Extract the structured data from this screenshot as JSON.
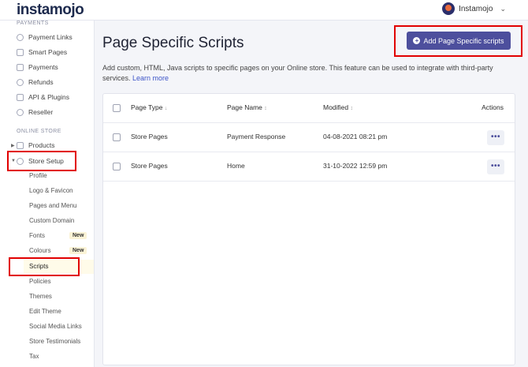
{
  "app": {
    "logo": "instamojo"
  },
  "user": {
    "name": "Instamojo"
  },
  "sidebar": {
    "payments_label": "PAYMENTS",
    "payments": [
      {
        "label": "Payment Links",
        "icon": "link-icon"
      },
      {
        "label": "Smart Pages",
        "icon": "page-icon"
      },
      {
        "label": "Payments",
        "icon": "card-icon"
      },
      {
        "label": "Refunds",
        "icon": "refund-icon"
      },
      {
        "label": "API & Plugins",
        "icon": "plug-icon"
      },
      {
        "label": "Reseller",
        "icon": "reseller-icon"
      }
    ],
    "store_label": "ONLINE STORE",
    "products": "Products",
    "store_setup": "Store Setup",
    "sub": [
      {
        "label": "Profile"
      },
      {
        "label": "Logo & Favicon"
      },
      {
        "label": "Pages and Menu"
      },
      {
        "label": "Custom Domain"
      },
      {
        "label": "Fonts",
        "badge": "New"
      },
      {
        "label": "Colours",
        "badge": "New"
      },
      {
        "label": "Scripts",
        "active": true
      },
      {
        "label": "Policies"
      },
      {
        "label": "Themes"
      },
      {
        "label": "Edit Theme"
      },
      {
        "label": "Social Media Links"
      },
      {
        "label": "Store Testimonials"
      },
      {
        "label": "Tax"
      }
    ]
  },
  "main": {
    "title": "Page Specific Scripts",
    "add_button": "Add Page Specific scripts",
    "description": "Add custom, HTML, Java scripts to specific pages on your Online store. This feature can be used to integrate with third-party services.",
    "learn_more": "Learn more",
    "table": {
      "headers": {
        "type": "Page Type",
        "name": "Page Name",
        "modified": "Modified",
        "actions": "Actions"
      },
      "rows": [
        {
          "type": "Store Pages",
          "name": "Payment Response",
          "modified": "04-08-2021 08:21 pm"
        },
        {
          "type": "Store Pages",
          "name": "Home",
          "modified": "31-10-2022 12:59 pm"
        }
      ]
    }
  },
  "colors": {
    "accent": "#4d4f9d",
    "highlight": "#e10000",
    "badge_bg": "#fbf3d6"
  }
}
